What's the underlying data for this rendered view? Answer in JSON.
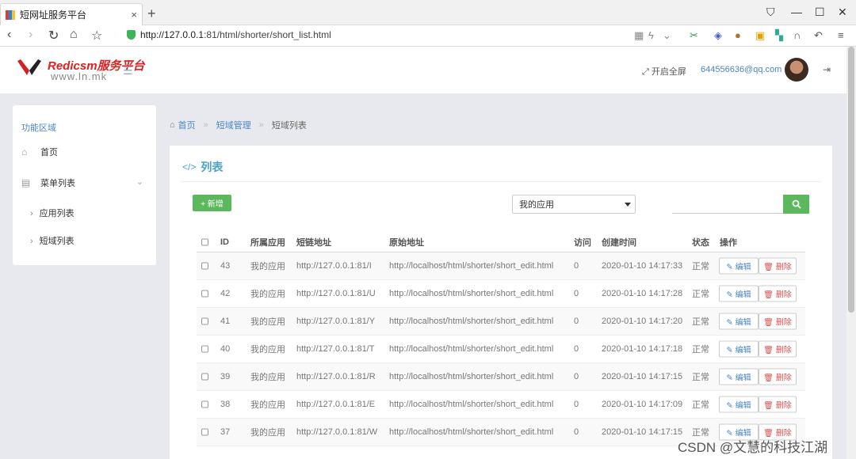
{
  "browser": {
    "tab_title": "短网址服务平台",
    "tab_close": "×",
    "new_tab": "+",
    "url_host": "http://127.0.0.1",
    "url_rest": ":81/html/shorter/short_list.html"
  },
  "header": {
    "brand": "Redicsm服务平台",
    "domain": "www.ln.mk",
    "fullscreen_label": "开启全屏",
    "user_email": "644556636@qq.com"
  },
  "sidebar": {
    "section_title": "功能区域",
    "home_label": "首页",
    "menu_label": "菜单列表",
    "sub_items": [
      "应用列表",
      "短域列表"
    ]
  },
  "breadcrumb": {
    "home": "首页",
    "section": "短域管理",
    "current": "短域列表",
    "separator": "»"
  },
  "panel": {
    "title": "列表",
    "add_label": "+ 新增",
    "select_value": "我的应用",
    "search_placeholder": ""
  },
  "table": {
    "headers": [
      "ID",
      "所属应用",
      "短链地址",
      "原始地址",
      "访问",
      "创建时间",
      "状态",
      "操作"
    ],
    "edit_label": "✎ 编辑",
    "delete_label": "🗑 删除",
    "rows": [
      {
        "id": "43",
        "app": "我的应用",
        "short": "http://127.0.0.1:81/I",
        "origin": "http://localhost/html/shorter/short_edit.html",
        "visits": "0",
        "created": "2020-01-10 14:17:33",
        "status": "正常"
      },
      {
        "id": "42",
        "app": "我的应用",
        "short": "http://127.0.0.1:81/U",
        "origin": "http://localhost/html/shorter/short_edit.html",
        "visits": "0",
        "created": "2020-01-10 14:17:28",
        "status": "正常"
      },
      {
        "id": "41",
        "app": "我的应用",
        "short": "http://127.0.0.1:81/Y",
        "origin": "http://localhost/html/shorter/short_edit.html",
        "visits": "0",
        "created": "2020-01-10 14:17:20",
        "status": "正常"
      },
      {
        "id": "40",
        "app": "我的应用",
        "short": "http://127.0.0.1:81/T",
        "origin": "http://localhost/html/shorter/short_edit.html",
        "visits": "0",
        "created": "2020-01-10 14:17:18",
        "status": "正常"
      },
      {
        "id": "39",
        "app": "我的应用",
        "short": "http://127.0.0.1:81/R",
        "origin": "http://localhost/html/shorter/short_edit.html",
        "visits": "0",
        "created": "2020-01-10 14:17:15",
        "status": "正常"
      },
      {
        "id": "38",
        "app": "我的应用",
        "short": "http://127.0.0.1:81/E",
        "origin": "http://localhost/html/shorter/short_edit.html",
        "visits": "0",
        "created": "2020-01-10 14:17:09",
        "status": "正常"
      },
      {
        "id": "37",
        "app": "我的应用",
        "short": "http://127.0.0.1:81/W",
        "origin": "http://localhost/html/shorter/short_edit.html",
        "visits": "0",
        "created": "2020-01-10 14:17:15",
        "status": "正常"
      }
    ]
  },
  "watermark": "CSDN @文慧的科技江湖",
  "colors": {
    "accent": "#4a86c5",
    "success": "#5cb85c",
    "danger": "#d9534f",
    "brand": "#e02020"
  }
}
